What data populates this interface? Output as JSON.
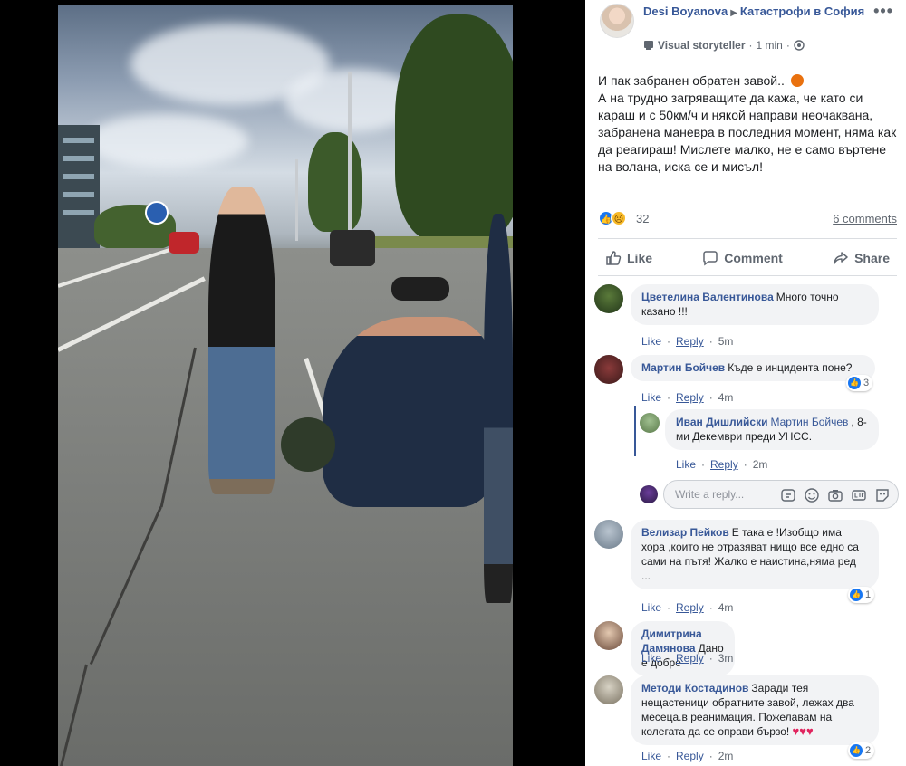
{
  "post": {
    "author": "Desi Boyanova",
    "group": "Катастрофи в София",
    "badge": "Visual storyteller",
    "time": "1 min",
    "more": "•••",
    "text_lines": [
      "И пак забранен обратен завой.. ",
      "А на трудно загряващите да кажа, че като си караш и с 50км/ч и някой направи неочаквана, забранена маневра в последния момент, няма как да реагираш! Мислете малко, не е само въртене на волана, иска се и мисъл!"
    ],
    "reactions_count": "32",
    "comments_count": "6 comments",
    "actions": {
      "like": "Like",
      "comment": "Comment",
      "share": "Share"
    }
  },
  "comments": [
    {
      "name": "Цветелина Валентинова",
      "text": "Много точно казано !!!",
      "like": "Like",
      "reply": "Reply",
      "time": "5m"
    },
    {
      "name": "Мартин Бойчев",
      "text": "Къде е инцидента поне?",
      "like": "Like",
      "reply": "Reply",
      "time": "4m",
      "reactions": "3"
    },
    {
      "name": "Иван Дишлийски",
      "mention": "Мартин Бойчев",
      "text": ", 8-ми Декември преди УНСС.",
      "like": "Like",
      "reply": "Reply",
      "time": "2m"
    },
    {
      "name": "Велизар Пейков",
      "text": "Е така е !Изобщо има хора ,които не отразяват нищо все едно са сами на пътя! Жалко е наистина,няма ред ...",
      "like": "Like",
      "reply": "Reply",
      "time": "4m",
      "reactions": "1"
    },
    {
      "name": "Димитрина Дамянова",
      "text": "Дано е добре",
      "like": "Like",
      "reply": "Reply",
      "time": "3m"
    },
    {
      "name": "Методи Костадинов",
      "text": "Заради тея нещастеници обратните завой, лежах два месеца.в реанимация. Пожелавам на колегата да се оправи бързо!",
      "like": "Like",
      "reply": "Reply",
      "time": "2m",
      "reactions": "2"
    }
  ],
  "write_reply": {
    "placeholder": "Write a reply..."
  },
  "colors": {
    "link": "#385898",
    "bubble": "#f2f3f5",
    "like_blue": "#1877f2",
    "heart": "#e0245e"
  }
}
